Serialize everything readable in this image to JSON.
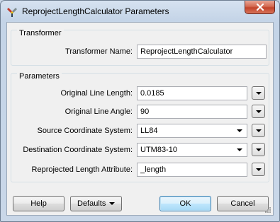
{
  "window": {
    "title": "ReprojectLengthCalculator Parameters"
  },
  "transformer_group": {
    "title": "Transformer",
    "name_label": "Transformer Name:",
    "name_value": "ReprojectLengthCalculator"
  },
  "parameters_group": {
    "title": "Parameters",
    "rows": [
      {
        "label": "Original Line Length:",
        "value": "0.0185"
      },
      {
        "label": "Original Line Angle:",
        "value": "90"
      },
      {
        "label": "Source Coordinate System:",
        "value": "LL84"
      },
      {
        "label": "Destination Coordinate System:",
        "value": "UTM83-10"
      },
      {
        "label": "Reprojected Length Attribute:",
        "value": "_length"
      }
    ]
  },
  "buttons": {
    "help": "Help",
    "defaults": "Defaults",
    "ok": "OK",
    "cancel": "Cancel"
  },
  "icons": {
    "app": "fme-workbench-icon",
    "close": "close-icon"
  },
  "colors": {
    "close_button": "#c2432a",
    "default_button_border": "#3c7fb1",
    "dialog_background": "#f0f0f0",
    "title_bar": "#c4d4e7"
  }
}
